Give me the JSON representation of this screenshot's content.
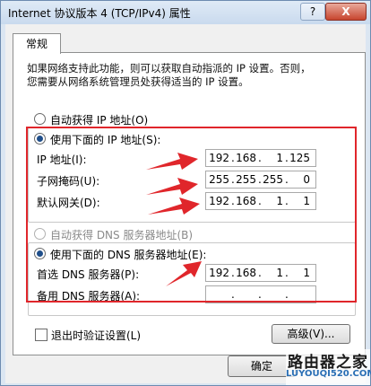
{
  "window": {
    "title": "Internet 协议版本 4 (TCP/IPv4) 属性",
    "help_label": "?",
    "close_label": "X"
  },
  "tab": {
    "label": "常规"
  },
  "description": {
    "line1": "如果网络支持此功能，则可以获取自动指派的 IP 设置。否则，",
    "line2": "您需要从网络系统管理员处获得适当的 IP 设置。"
  },
  "ip_mode": {
    "auto_label": "自动获得 IP 地址(O)",
    "manual_label": "使用下面的 IP 地址(S):",
    "selected": "manual"
  },
  "ip_fields": [
    {
      "label": "IP 地址(I):",
      "octets": [
        "192",
        "168",
        "1",
        "125"
      ]
    },
    {
      "label": "子网掩码(U):",
      "octets": [
        "255",
        "255",
        "255",
        "0"
      ]
    },
    {
      "label": "默认网关(D):",
      "octets": [
        "192",
        "168",
        "1",
        "1"
      ]
    }
  ],
  "dns_mode": {
    "auto_label": "自动获得 DNS 服务器地址(B)",
    "manual_label": "使用下面的 DNS 服务器地址(E):",
    "selected": "manual"
  },
  "dns_fields": [
    {
      "label": "首选 DNS 服务器(P):",
      "octets": [
        "192",
        "168",
        "1",
        "1"
      ]
    },
    {
      "label": "备用 DNS 服务器(A):",
      "octets": [
        "",
        "",
        "",
        ""
      ]
    }
  ],
  "validate_checkbox": {
    "label": "退出时验证设置(L)",
    "checked": false
  },
  "buttons": {
    "advanced": "高级(V)...",
    "ok": "确定"
  },
  "watermark": {
    "name": "路由器之家",
    "url": "LUYOUQI520.COM"
  },
  "colors": {
    "highlight": "#e0262b",
    "accent": "#1f4e8a"
  }
}
